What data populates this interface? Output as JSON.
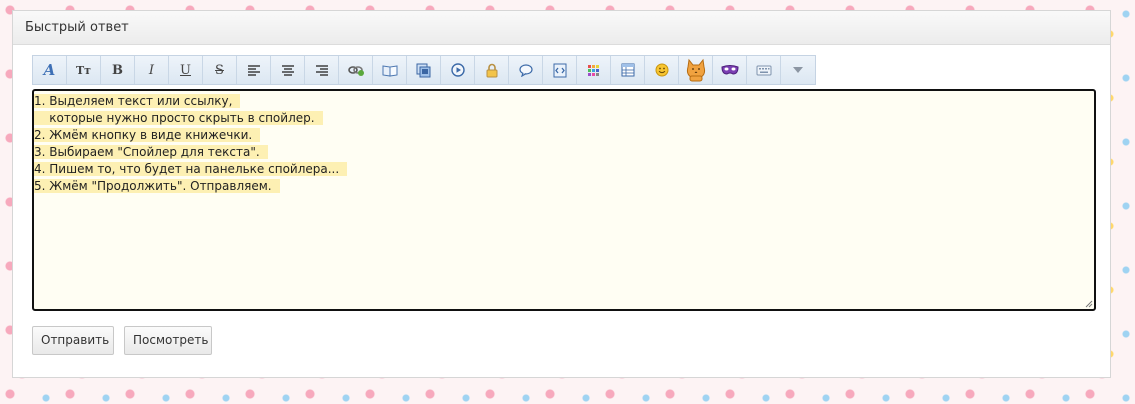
{
  "panel": {
    "title": "Быстрый ответ"
  },
  "toolbar": {
    "buttons": [
      {
        "name": "font-style-button",
        "icon": "font-a-icon"
      },
      {
        "name": "font-size-button",
        "icon": "font-size-tt-icon",
        "label": "Tт"
      },
      {
        "name": "bold-button",
        "icon": "bold-icon",
        "label": "B"
      },
      {
        "name": "italic-button",
        "icon": "italic-icon",
        "label": "I"
      },
      {
        "name": "underline-button",
        "icon": "underline-icon",
        "label": "U"
      },
      {
        "name": "strikethrough-button",
        "icon": "strikethrough-icon",
        "label": "S"
      },
      {
        "name": "align-left-button",
        "icon": "align-left-icon"
      },
      {
        "name": "align-center-button",
        "icon": "align-center-icon"
      },
      {
        "name": "align-right-button",
        "icon": "align-right-icon"
      },
      {
        "name": "link-button",
        "icon": "link-icon"
      },
      {
        "name": "spoiler-book-button",
        "icon": "book-icon"
      },
      {
        "name": "image-button",
        "icon": "image-icon"
      },
      {
        "name": "video-button",
        "icon": "play-icon"
      },
      {
        "name": "hide-button",
        "icon": "lock-icon"
      },
      {
        "name": "quote-button",
        "icon": "speech-bubble-icon"
      },
      {
        "name": "code-button",
        "icon": "code-icon"
      },
      {
        "name": "color-button",
        "icon": "color-palette-icon"
      },
      {
        "name": "table-button",
        "icon": "table-icon"
      },
      {
        "name": "smiley-button",
        "icon": "smiley-icon"
      },
      {
        "name": "cat-smiley-button",
        "icon": "cat-icon"
      },
      {
        "name": "mask-button",
        "icon": "mask-icon"
      },
      {
        "name": "keyboard-button",
        "icon": "keyboard-icon"
      },
      {
        "name": "more-button",
        "icon": "triangle-down-icon"
      }
    ]
  },
  "editor": {
    "lines": [
      "1. Выделяем текст или ссылку,",
      "    которые нужно просто скрыть в спойлер.",
      "2. Жмём кнопку в виде книжечки.",
      "3. Выбираем \"Спойлер для текста\".",
      "4. Пишем то, что будет на панельке спойлера...",
      "5. Жмём \"Продолжить\". Отправляем."
    ]
  },
  "actions": {
    "submit_label": "Отправить",
    "preview_label": "Посмотреть"
  },
  "colors": {
    "editor_bg": "#fffef3",
    "selection": "#fdf0b3",
    "toolbar_bg": "#dce7f2"
  }
}
